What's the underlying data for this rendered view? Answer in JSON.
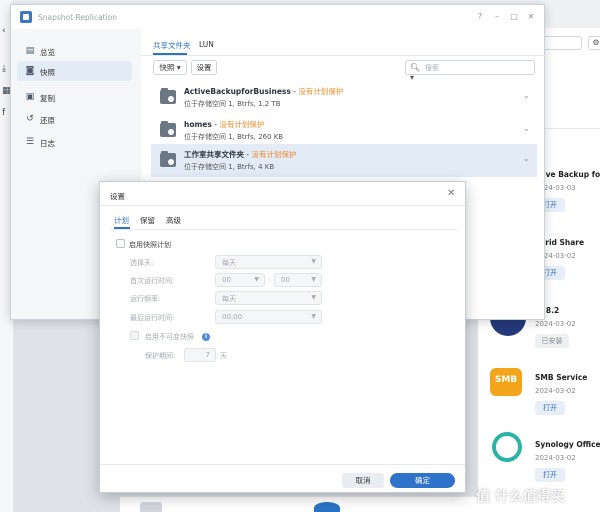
{
  "window": {
    "title": "Snapshot Replication",
    "controls": [
      "?",
      "–",
      "□",
      "✕"
    ]
  },
  "sidebar": {
    "items": [
      {
        "label": "总览",
        "icon": "overview-icon"
      },
      {
        "label": "快照",
        "icon": "camera-icon",
        "active": true
      },
      {
        "label": "复制",
        "icon": "replication-icon"
      },
      {
        "label": "还原",
        "icon": "restore-icon"
      },
      {
        "label": "日志",
        "icon": "log-icon"
      }
    ]
  },
  "tabs": [
    {
      "label": "共享文件夹",
      "active": true
    },
    {
      "label": "LUN"
    }
  ],
  "toolbar": {
    "snapshot_label": "快照",
    "settings_label": "设置",
    "search_placeholder": "搜索"
  },
  "rows": [
    {
      "name": "ActiveBackupforBusiness",
      "sep": " - ",
      "status": "没有计划保护",
      "sub": "位于存储空间 1, Btrfs, 1.2 TB"
    },
    {
      "name": "homes",
      "sep": " - ",
      "status": "没有计划保护",
      "sub": "位于存储空间 1, Btrfs, 260 KB"
    },
    {
      "name": "工作室共享文件夹",
      "sep": " - ",
      "status": "没有计划保护",
      "sub": "位于存储空间 1, Btrfs, 4 KB",
      "selected": true
    }
  ],
  "dialog": {
    "title": "设置",
    "tabs": [
      "计划",
      "保留",
      "高级"
    ],
    "enable_schedule": "启用快照计划",
    "fields": {
      "select_days_label": "选择天:",
      "select_days_value": "每天",
      "first_run_label": "首次运行时间:",
      "first_run_hour": "00",
      "first_run_minute": "00",
      "frequency_label": "运行频率:",
      "frequency_value": "每天",
      "last_run_label": "最后运行时间:",
      "last_run_value": "00:00"
    },
    "immutable_label": "启用不可变快照",
    "protection_label": "保护期间:",
    "protection_value": "7",
    "protection_unit": "天",
    "cancel": "取消",
    "ok": "确定"
  },
  "package_center": {
    "items": [
      {
        "name": "ctive Backup fo",
        "date": "2024-03-03",
        "button": "打开"
      },
      {
        "name": "ybrid Share",
        "date": "2024-03-02",
        "button": "打开"
      },
      {
        "name": "IP 8.2",
        "date": "2024-03-02",
        "button": "已安装"
      },
      {
        "name": "SMB Service",
        "date": "2024-03-02",
        "button": "打开",
        "icon_text": "SMB"
      },
      {
        "name": "Synology Office",
        "date": "2024-03-02",
        "button": "打开"
      }
    ]
  },
  "watermark": "值 什么值得买",
  "colors": {
    "accent": "#2f72c9",
    "warning": "#f08a24",
    "selected_row": "#e2ebf6"
  }
}
